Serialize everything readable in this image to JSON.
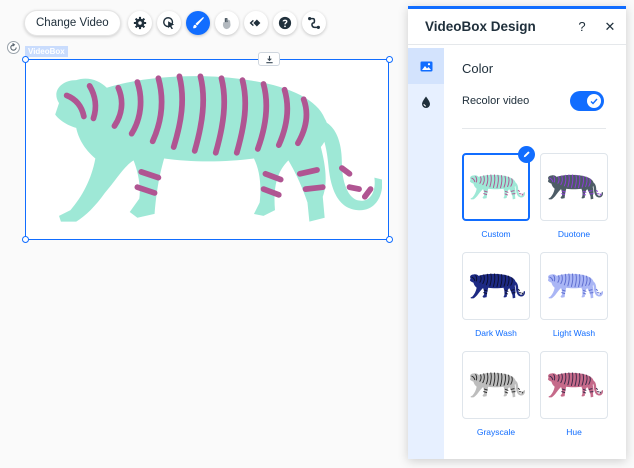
{
  "toolbar": {
    "change_video_label": "Change Video",
    "icons": [
      "gear-icon",
      "cursor-click-icon",
      "paintbrush-icon",
      "hand-icon",
      "animation-icon",
      "help-icon",
      "connect-icon"
    ]
  },
  "canvas": {
    "element_label": "VideoBox"
  },
  "panel": {
    "title": "VideoBox Design",
    "help_label": "?",
    "close_label": "✕",
    "section_title": "Color",
    "recolor_label": "Recolor video",
    "recolor_enabled": true,
    "selected_preset": "Custom",
    "presets": [
      {
        "label": "Custom",
        "body": "#9ee8d6",
        "stripe": "#b05592"
      },
      {
        "label": "Duotone",
        "body": "#4d5c66",
        "stripe": "#8c3bd8"
      },
      {
        "label": "Dark Wash",
        "body": "#1d2a84",
        "stripe": "#0c1030"
      },
      {
        "label": "Light Wash",
        "body": "#aab6f5",
        "stripe": "#5e6ed0"
      },
      {
        "label": "Grayscale",
        "body": "#bdbdbd",
        "stripe": "#2b2b2b"
      },
      {
        "label": "Hue",
        "body": "#c56a8a",
        "stripe": "#3c2a4a"
      }
    ]
  },
  "colors": {
    "accent": "#116dff",
    "tiger_body": "#9ee8d6",
    "tiger_stripes": "#b05592"
  }
}
